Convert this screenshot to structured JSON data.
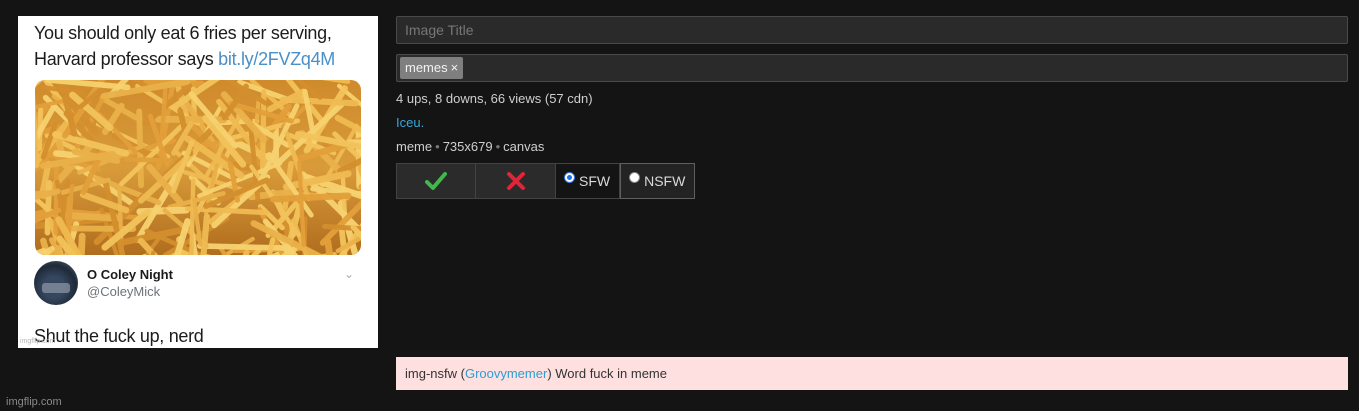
{
  "meme": {
    "caption_line1": "You should only eat 6 fries per serving,",
    "caption_line2_prefix": "Harvard professor says ",
    "caption_link": "bit.ly/2FVZq4M",
    "user_name": "O Coley Night",
    "user_handle": "@ColeyMick",
    "reply_text": "Shut the fuck up, nerd",
    "watermark": "imgflip.com"
  },
  "page_watermark": "imgflip.com",
  "title_input": {
    "placeholder": "Image Title",
    "value": ""
  },
  "tags": [
    {
      "label": "memes",
      "remove": "×"
    }
  ],
  "stats": "4 ups, 8 downs, 66 views (57 cdn)",
  "author": "Iceu.",
  "meta": {
    "stream": "meme",
    "dimensions": "735x679",
    "type": "canvas",
    "separator": "•"
  },
  "actions": {
    "approve_icon": "check-mark-icon",
    "reject_icon": "cross-mark-icon",
    "approve_color": "#3fb94a",
    "reject_color": "#e0243a",
    "sfw_label": "SFW",
    "nsfw_label": "NSFW",
    "selected": "SFW"
  },
  "flag": {
    "prefix": "img-nsfw (",
    "user": "Groovymemer",
    "suffix": ") Word fuck in meme",
    "background": "#ffe0e0"
  }
}
